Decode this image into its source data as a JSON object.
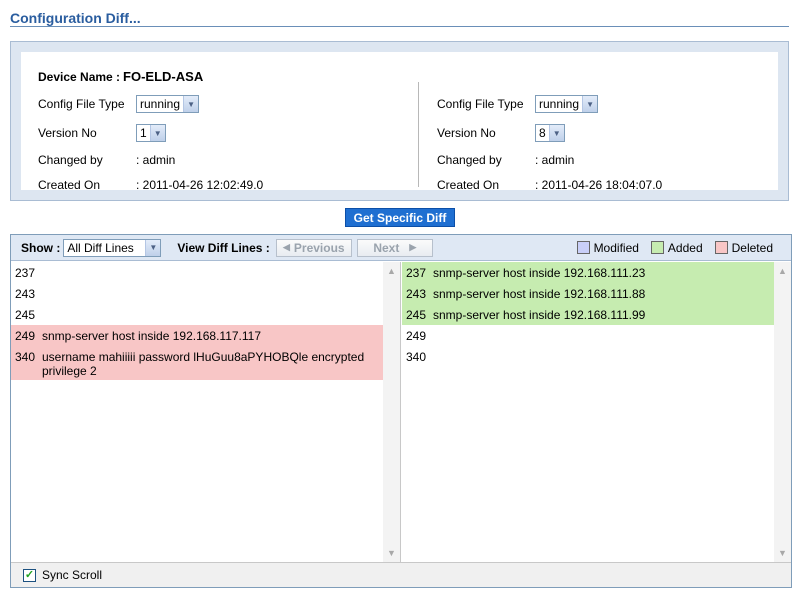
{
  "page": {
    "title": "Configuration  Diff..."
  },
  "device": {
    "label": "Device Name :",
    "value": "FO-ELD-ASA"
  },
  "left_config": {
    "config_file_type_label": "Config File Type",
    "config_file_type_value": "running",
    "version_label": "Version No",
    "version_value": "1",
    "changed_by_label": "Changed by",
    "changed_by_value": ": admin",
    "created_on_label": "Created On",
    "created_on_value": ": 2011-04-26 12:02:49.0"
  },
  "right_config": {
    "config_file_type_label": "Config File Type",
    "config_file_type_value": "running",
    "version_label": "Version No",
    "version_value": "8",
    "changed_by_label": "Changed by",
    "changed_by_value": ": admin",
    "created_on_label": "Created On",
    "created_on_value": ": 2011-04-26 18:04:07.0"
  },
  "actions": {
    "get_specific_diff": "Get Specific Diff"
  },
  "toolbar": {
    "show_label": "Show :",
    "show_value": "All Diff Lines",
    "view_diff_label": "View Diff Lines :",
    "previous_label": "Previous",
    "next_label": "Next",
    "legend": [
      {
        "label": "Modified",
        "color": "#c9cff8"
      },
      {
        "label": "Added",
        "color": "#c6ecb0"
      },
      {
        "label": "Deleted",
        "color": "#f8c6c6"
      }
    ]
  },
  "left_pane": {
    "lines": [
      {
        "num": "237",
        "text": "",
        "status": "none"
      },
      {
        "num": "243",
        "text": "",
        "status": "none"
      },
      {
        "num": "245",
        "text": "",
        "status": "none"
      },
      {
        "num": "249",
        "text": "snmp-server host inside 192.168.117.117",
        "status": "deleted"
      },
      {
        "num": "340",
        "text": "username mahiiiii password lHuGuu8aPYHOBQle encrypted privilege 2",
        "status": "deleted"
      }
    ]
  },
  "right_pane": {
    "lines": [
      {
        "num": "237",
        "text": "snmp-server host inside 192.168.111.23",
        "status": "added"
      },
      {
        "num": "243",
        "text": "snmp-server host inside 192.168.111.88",
        "status": "added"
      },
      {
        "num": "245",
        "text": "snmp-server host inside 192.168.111.99",
        "status": "added"
      },
      {
        "num": "249",
        "text": "",
        "status": "none"
      },
      {
        "num": "340",
        "text": "",
        "status": "none"
      }
    ]
  },
  "footer": {
    "sync_scroll_label": "Sync Scroll",
    "sync_scroll_checked": true
  },
  "colors": {
    "accent": "#2a5d9f",
    "button": "#1f6fd1",
    "deleted": "#f8c6c6",
    "added": "#c6ecb0",
    "modified": "#c9cff8"
  }
}
